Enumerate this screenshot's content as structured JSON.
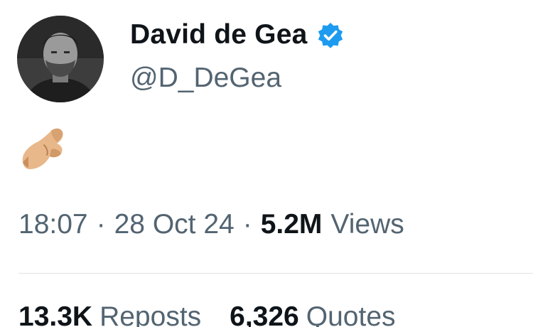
{
  "user": {
    "display_name": "David de Gea",
    "handle": "@D_DeGea",
    "verified": true,
    "verified_color": "#1d9bf0"
  },
  "tweet": {
    "content_emoji": "pinched-fingers-emoji"
  },
  "meta": {
    "time": "18:07",
    "separator": "·",
    "date": "28 Oct 24",
    "views_count": "5.2M",
    "views_label": "Views"
  },
  "stats": {
    "reposts_count": "13.3K",
    "reposts_label": "Reposts",
    "quotes_count": "6,326",
    "quotes_label": "Quotes"
  },
  "colors": {
    "text_primary": "#0f1419",
    "text_secondary": "#536471",
    "divider": "#dfe3e7"
  }
}
